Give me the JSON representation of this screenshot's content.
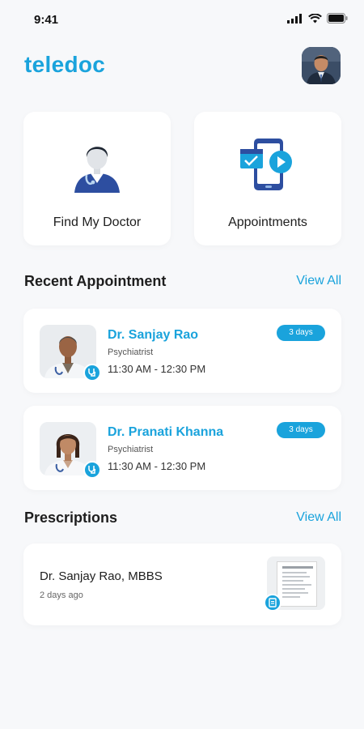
{
  "status_bar": {
    "time": "9:41"
  },
  "header": {
    "title": "teledoc"
  },
  "tiles": [
    {
      "label": "Find My Doctor",
      "icon": "doctor-icon"
    },
    {
      "label": "Appointments",
      "icon": "appointments-icon"
    }
  ],
  "recent": {
    "title": "Recent Appointment",
    "view_all": "View All",
    "items": [
      {
        "name": "Dr. Sanjay Rao",
        "specialty": "Psychiatrist",
        "time": "11:30 AM - 12:30 PM",
        "badge": "3 days"
      },
      {
        "name": "Dr. Pranati Khanna",
        "specialty": "Psychiatrist",
        "time": "11:30 AM - 12:30 PM",
        "badge": "3 days"
      }
    ]
  },
  "prescriptions": {
    "title": "Prescriptions",
    "view_all": "View All",
    "items": [
      {
        "title": "Dr. Sanjay Rao, MBBS",
        "date": "2 days ago"
      }
    ]
  },
  "colors": {
    "accent": "#1aa3dc",
    "background": "#f7f8fa",
    "card": "#ffffff"
  }
}
